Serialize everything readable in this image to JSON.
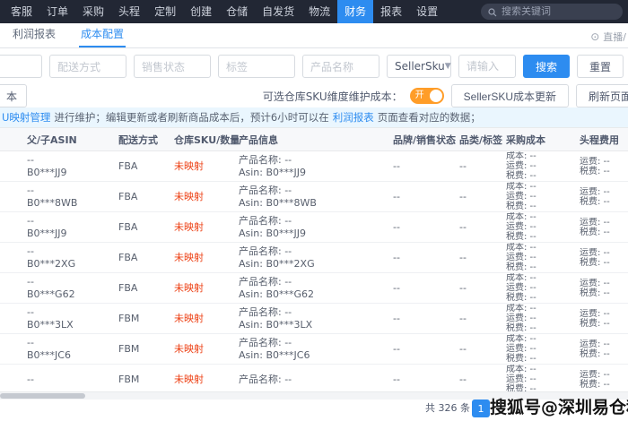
{
  "topnav": {
    "items": [
      "客服",
      "订单",
      "采购",
      "头程",
      "定制",
      "创建",
      "仓储",
      "自发货",
      "物流",
      "财务",
      "报表",
      "设置"
    ],
    "active_item": "财务",
    "search_placeholder": "搜索关键词"
  },
  "tabbar": {
    "tabs": [
      {
        "label": "利润报表",
        "active": false
      },
      {
        "label": "成本配置",
        "active": true
      }
    ],
    "right_label": "直播/"
  },
  "filters": {
    "fields": [
      "配送方式",
      "销售状态",
      "标签",
      "产品名称"
    ],
    "sku_select_value": "SellerSku",
    "keyword_placeholder": "请输入",
    "search_label": "搜索",
    "reset_label": "重置"
  },
  "toolbar": {
    "left_button_label": "本",
    "sku_dim_label": "可选仓库SKU维度维护成本：",
    "toggle_label": "开",
    "update_button_label": "SellerSKU成本更新",
    "refresh_button_label": "刷新页面"
  },
  "notice": {
    "link_mapping": "U映射管理",
    "text_before": "进行维护；编辑更新或者刷新商品成本后，预计6小时可以在",
    "link_report": "利润报表",
    "text_after": "页面查看对应的数据；"
  },
  "table": {
    "columns": [
      "父/子ASIN",
      "配送方式",
      "仓库SKU/数量",
      "产品信息",
      "品牌/销售状态",
      "品类/标签",
      "采购成本",
      "头程费用"
    ],
    "rows": [
      {
        "parent": "--",
        "asin": "B0***JJ9",
        "delivery": "FBA",
        "mapping": "未映射",
        "product_name": "产品名称: --",
        "product_asin": "Asin: B0***JJ9",
        "brand": "--",
        "category": "--",
        "cost": [
          "成本: --",
          "运费: --",
          "税费: --"
        ],
        "head": [
          "运费: --",
          "税费: --"
        ]
      },
      {
        "parent": "--",
        "asin": "B0***8WB",
        "delivery": "FBA",
        "mapping": "未映射",
        "product_name": "产品名称: --",
        "product_asin": "Asin: B0***8WB",
        "brand": "--",
        "category": "--",
        "cost": [
          "成本: --",
          "运费: --",
          "税费: --"
        ],
        "head": [
          "运费: --",
          "税费: --"
        ]
      },
      {
        "parent": "--",
        "asin": "B0***JJ9",
        "delivery": "FBA",
        "mapping": "未映射",
        "product_name": "产品名称: --",
        "product_asin": "Asin: B0***JJ9",
        "brand": "--",
        "category": "--",
        "cost": [
          "成本: --",
          "运费: --",
          "税费: --"
        ],
        "head": [
          "运费: --",
          "税费: --"
        ]
      },
      {
        "parent": "--",
        "asin": "B0***2XG",
        "delivery": "FBA",
        "mapping": "未映射",
        "product_name": "产品名称: --",
        "product_asin": "Asin: B0***2XG",
        "brand": "--",
        "category": "--",
        "cost": [
          "成本: --",
          "运费: --",
          "税费: --"
        ],
        "head": [
          "运费: --",
          "税费: --"
        ]
      },
      {
        "parent": "--",
        "asin": "B0***G62",
        "delivery": "FBA",
        "mapping": "未映射",
        "product_name": "产品名称: --",
        "product_asin": "Asin: B0***G62",
        "brand": "--",
        "category": "--",
        "cost": [
          "成本: --",
          "运费: --",
          "税费: --"
        ],
        "head": [
          "运费: --",
          "税费: --"
        ]
      },
      {
        "parent": "--",
        "asin": "B0***3LX",
        "delivery": "FBM",
        "mapping": "未映射",
        "product_name": "产品名称: --",
        "product_asin": "Asin: B0***3LX",
        "brand": "--",
        "category": "--",
        "cost": [
          "成本: --",
          "运费: --",
          "税费: --"
        ],
        "head": [
          "运费: --",
          "税费: --"
        ]
      },
      {
        "parent": "--",
        "asin": "B0***JC6",
        "delivery": "FBM",
        "mapping": "未映射",
        "product_name": "产品名称: --",
        "product_asin": "Asin: B0***JC6",
        "brand": "--",
        "category": "--",
        "cost": [
          "成本: --",
          "运费: --",
          "税费: --"
        ],
        "head": [
          "运费: --",
          "税费: --"
        ]
      },
      {
        "parent": "--",
        "asin": "",
        "delivery": "FBM",
        "mapping": "未映射",
        "product_name": "产品名称: --",
        "product_asin": "",
        "brand": "--",
        "category": "--",
        "cost": [
          "成本: --",
          "运费: --",
          "税费: --"
        ],
        "head": [
          "运费: --",
          "税费: --"
        ]
      }
    ]
  },
  "pagination": {
    "total_label": "共 326 条",
    "current_page": "1"
  },
  "watermark_text": "搜狐号@深圳易仓科",
  "colors": {
    "accent": "#2d8cf0",
    "nav_bg": "#222734",
    "mapping_warning": "#ed4014",
    "toggle_on": "#ff9d28",
    "notice_bg": "#eaf6fe"
  }
}
